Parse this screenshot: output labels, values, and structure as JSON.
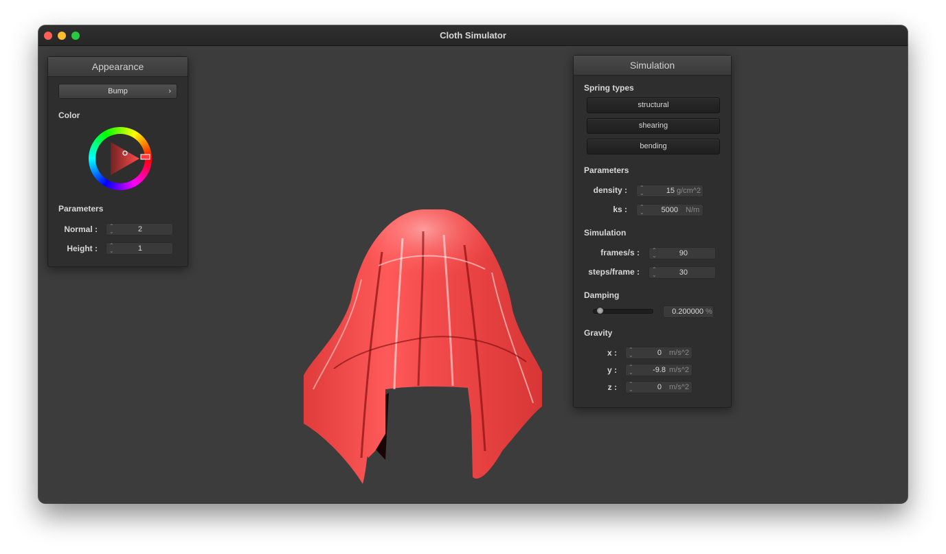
{
  "window": {
    "title": "Cloth Simulator"
  },
  "appearance": {
    "title": "Appearance",
    "shader": "Bump",
    "color_label": "Color",
    "selected_color": "#ff4c4c",
    "params_label": "Parameters",
    "normal_label": "Normal :",
    "normal_value": "2",
    "height_label": "Height :",
    "height_value": "1"
  },
  "simulation": {
    "title": "Simulation",
    "spring_types_label": "Spring types",
    "springs": [
      "structural",
      "shearing",
      "bending"
    ],
    "parameters_label": "Parameters",
    "density_label": "density :",
    "density_value": "15",
    "density_unit": "g/cm^2",
    "ks_label": "ks :",
    "ks_value": "5000",
    "ks_unit": "N/m",
    "simulation_label": "Simulation",
    "fps_label": "frames/s :",
    "fps_value": "90",
    "steps_label": "steps/frame :",
    "steps_value": "30",
    "damping_label": "Damping",
    "damping_value": "0.200000",
    "damping_unit": "%",
    "damping_fraction": 0.2,
    "gravity_label": "Gravity",
    "gx_label": "x :",
    "gx_value": "0",
    "gy_label": "y :",
    "gy_value": "-9.8",
    "gz_label": "z :",
    "gz_value": "0",
    "gravity_unit": "m/s^2"
  },
  "colors": {
    "cloth": "#f04848",
    "background": "#3c3c3c"
  }
}
